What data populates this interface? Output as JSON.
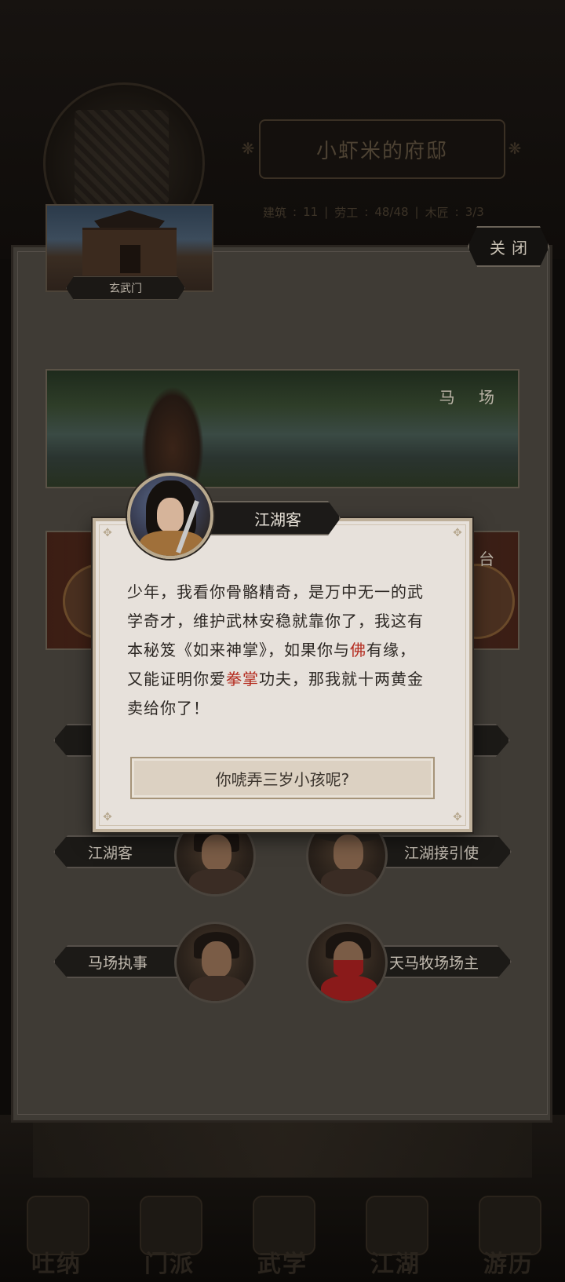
{
  "background": {
    "residence_title": "小虾米的府邸",
    "stats": [
      {
        "label": "建筑",
        "value": "11"
      },
      {
        "label": "劳工",
        "value": "48/48"
      },
      {
        "label": "木匠",
        "value": "3/3"
      }
    ],
    "nav": [
      {
        "label": "吐纳",
        "icon": "meditation-icon"
      },
      {
        "label": "门派",
        "icon": "sect-icon"
      },
      {
        "label": "武学",
        "icon": "scroll-icon"
      },
      {
        "label": "江湖",
        "icon": "jianghu-icon"
      },
      {
        "label": "游历",
        "icon": "horse-icon"
      }
    ]
  },
  "panel": {
    "close_label": "关闭",
    "location_name": "玄武门",
    "scenes": [
      {
        "label": "马 场"
      },
      {
        "label": "擂 台"
      }
    ],
    "npcs": [
      {
        "name": "江湖客",
        "side": "left"
      },
      {
        "name": "江湖接引使",
        "side": "right"
      },
      {
        "name": "马场执事",
        "side": "left"
      },
      {
        "name": "天马牧场场主",
        "side": "right"
      }
    ]
  },
  "dialog": {
    "speaker": "江湖客",
    "text_line1": "少年，我看你骨骼精奇，是万中无一的武",
    "text_line2": "学奇才，维护武林安稳就靠你了，我这有",
    "text_line3_a": "本秘笈《如来神掌》，如果你与",
    "text_line3_hl": "佛",
    "text_line3_b": "有缘，",
    "text_line4_a": "又能证明你爱",
    "text_line4_hl": "拳掌",
    "text_line4_b": "功夫，那我就十两黄金",
    "text_line5": "卖给你了！",
    "answer_label": "你唬弄三岁小孩呢?",
    "highlight_color": "#b42a1e"
  }
}
